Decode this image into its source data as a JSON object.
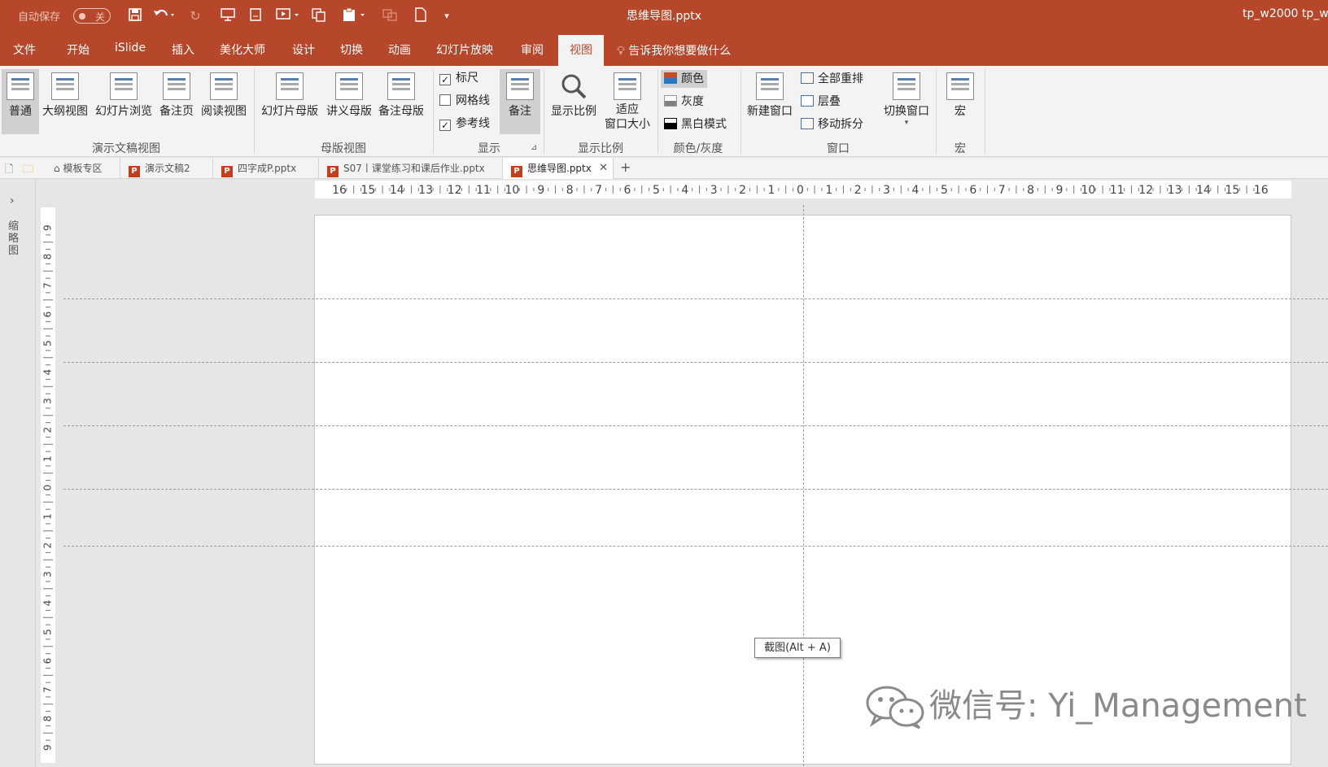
{
  "titlebar": {
    "autosave_label": "自动保存",
    "autosave_state": "关",
    "doc_title": "思维导图.pptx",
    "user": "tp_w2000 tp_w",
    "icons": [
      "save-icon",
      "undo-icon",
      "redo-icon",
      "present-from-start-icon",
      "new-slide-icon",
      "slide-show-icon",
      "copy-icon",
      "paste-icon",
      "format-painter-icon",
      "new-document-icon",
      "customize-qat-icon"
    ]
  },
  "menu": {
    "tabs": [
      "文件",
      "开始",
      "iSlide",
      "插入",
      "美化大师",
      "设计",
      "切换",
      "动画",
      "幻灯片放映",
      "审阅",
      "视图"
    ],
    "active_tab": "视图",
    "tell_me": "告诉我你想要做什么"
  },
  "ribbon": {
    "presentation_views": {
      "group_name": "演示文稿视图",
      "buttons": [
        "普通",
        "大纲视图",
        "幻灯片浏览",
        "备注页",
        "阅读视图"
      ],
      "selected": "普通"
    },
    "master_views": {
      "group_name": "母版视图",
      "buttons": [
        "幻灯片母版",
        "讲义母版",
        "备注母版"
      ]
    },
    "show": {
      "group_name": "显示",
      "ruler": {
        "label": "标尺",
        "checked": true
      },
      "gridlines": {
        "label": "网格线",
        "checked": false
      },
      "guides": {
        "label": "参考线",
        "checked": true
      },
      "notes_button": "备注"
    },
    "zoom": {
      "group_name": "显示比例",
      "zoom_button": "显示比例",
      "fit_line1": "适应",
      "fit_line2": "窗口大小"
    },
    "color": {
      "group_name": "颜色/灰度",
      "items": [
        "颜色",
        "灰度",
        "黑白模式"
      ],
      "selected": "颜色"
    },
    "window": {
      "group_name": "窗口",
      "new_window": "新建窗口",
      "arrange_all": "全部重排",
      "cascade": "层叠",
      "move_split": "移动拆分",
      "switch_windows": "切换窗口"
    },
    "macros": {
      "group_name": "宏",
      "button": "宏"
    }
  },
  "doc_tabs": {
    "items": [
      "模板专区",
      "演示文稿2",
      "四字成P.pptx",
      "S07丨课堂练习和课后作业.pptx",
      "思维导图.pptx"
    ],
    "active": "思维导图.pptx",
    "add": "+"
  },
  "thumbnail_pane": {
    "label": "缩略图",
    "expand": "›"
  },
  "ruler": {
    "h_ticks": [
      "16",
      "15",
      "14",
      "13",
      "12",
      "11",
      "10",
      "9",
      "8",
      "7",
      "6",
      "5",
      "4",
      "3",
      "2",
      "1",
      "0",
      "1",
      "2",
      "3",
      "4",
      "5",
      "6",
      "7",
      "8",
      "9",
      "10",
      "11",
      "12",
      "13",
      "14",
      "15",
      "16"
    ],
    "v_ticks": [
      "9",
      "8",
      "7",
      "6",
      "5",
      "4",
      "3",
      "2",
      "1",
      "0",
      "1",
      "2",
      "3",
      "4",
      "5",
      "6",
      "7",
      "8",
      "9"
    ]
  },
  "tooltip": "截图(Alt + A)",
  "watermark": "微信号: Yi_Management",
  "colors": {
    "accent": "#b7472a",
    "ribbon_bg": "#f3f3f3",
    "workspace_bg": "#e6e6e6",
    "swatch_color": "#d24726",
    "swatch_gray": "#808080",
    "swatch_bw": "#000000"
  }
}
